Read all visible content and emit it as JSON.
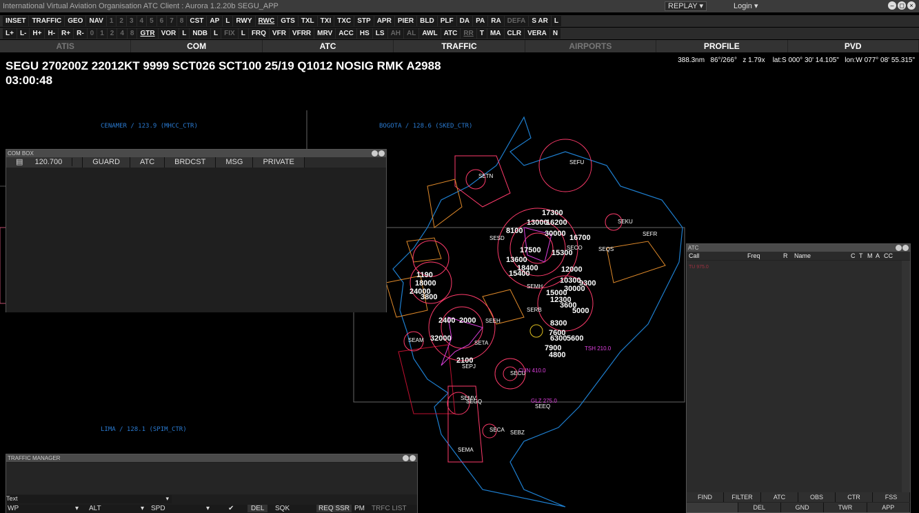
{
  "titlebar": {
    "title": "International Virtual Aviation Organisation  ATC Client : Aurora 1.2.20b  SEGU_APP",
    "replay": "REPLAY",
    "login": "Login"
  },
  "toolbar1": [
    "INSET",
    "TRAFFIC",
    "GEO",
    "NAV",
    "1",
    "2",
    "3",
    "4",
    "5",
    "6",
    "7",
    "8",
    "CST",
    "AP",
    "L",
    "RWY",
    "RWC",
    "GTS",
    "TXL",
    "TXI",
    "TXC",
    "STP",
    "APR",
    "PIER",
    "BLD",
    "PLF",
    "DA",
    "PA",
    "RA",
    "DEFA",
    "S AR",
    "L"
  ],
  "toolbar2": [
    "L+",
    "L-",
    "H+",
    "H-",
    "R+",
    "R-",
    "0",
    "1",
    "2",
    "4",
    "8",
    "GTR",
    "VOR",
    "L",
    "NDB",
    "L",
    "FIX",
    "L",
    "FRQ",
    "VFR",
    "VFRR",
    "MRV",
    "ACC",
    "HS",
    "LS",
    "AH",
    "AL",
    "AWL",
    "ATC",
    "RR",
    "T",
    "MA",
    "CLR",
    "VERA",
    "N"
  ],
  "tabs": [
    "ATIS",
    "COM",
    "ATC",
    "TRAFFIC",
    "AIRPORTS",
    "PROFILE",
    "PVD"
  ],
  "metar": "SEGU 270200Z 22012KT 9999 SCT026 SCT100 25/19 Q1012 NOSIG RMK A2988",
  "clock": "03:00:48",
  "status": {
    "range": "388.3nm",
    "bearing": "86°/266°",
    "zoom": "z 1.79x",
    "lat": "lat:S 000° 30' 14.105\"",
    "lon": "lon:W 077° 08' 55.315\""
  },
  "sectors": {
    "cenamer": "CENAMER / 123.9 (MHCC_CTR)",
    "bogota": "BOGOTA / 128.6 (SKED_CTR)",
    "lima": "LIMA / 128.1 (SPIM_CTR)"
  },
  "combox": {
    "title": "COM BOX",
    "freq": "120.700",
    "tabs": [
      "GUARD",
      "ATC",
      "BRDCST",
      "MSG",
      "PRIVATE"
    ]
  },
  "atc_window": {
    "title": "ATC",
    "headers": [
      "Call",
      "Freq",
      "R",
      "Name",
      "C",
      "T",
      "M",
      "A",
      "CC"
    ],
    "row": "TU 975.0",
    "buttons_top": [
      "FIND",
      "FILTER",
      "ATC",
      "OBS",
      "CTR",
      "FSS"
    ],
    "buttons_bottom": [
      "DEL",
      "GND",
      "TWR",
      "APP"
    ]
  },
  "traffic_manager": {
    "title": "TRAFFIC MANAGER",
    "text_label": "Text",
    "wp": "WP",
    "alt": "ALT",
    "spd": "SPD",
    "buttons": [
      "DEL",
      "SQK",
      "REQ SSR",
      "PM",
      "TRFC LIST"
    ]
  },
  "map": {
    "altitudes": [
      "17300",
      "13000",
      "16200",
      "8100",
      "30000",
      "16700",
      "17500",
      "15300",
      "13600",
      "12000",
      "18400",
      "15400",
      "10300",
      "9300",
      "30000",
      "15000",
      "12300",
      "3600",
      "5000",
      "8300",
      "7600",
      "6300",
      "5600",
      "7900",
      "4800",
      "2400",
      "2000",
      "2100",
      "32000",
      "1190",
      "18000",
      "24000",
      "3800"
    ],
    "fixes": [
      "SETN",
      "SEFU",
      "SEKU",
      "SEFR",
      "SEQS",
      "SECO",
      "SEEH",
      "SETA",
      "SEAM",
      "SEPJ",
      "SECU",
      "SEMV",
      "SEGQ",
      "SEEQ",
      "SEBZ",
      "SEMA",
      "SECA",
      "SERB",
      "SEMH",
      "SESD",
      "TSH 210.0",
      "CUN 410.0",
      "GLZ 275.0"
    ]
  },
  "colors": {
    "accent": "#ff3b3b",
    "magenta": "#e040e0",
    "coast": "#1e7fd0",
    "orange": "#e08a2a",
    "cyan": "#25c8c8"
  }
}
